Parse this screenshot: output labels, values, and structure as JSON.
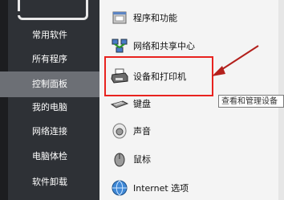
{
  "sidebar": {
    "items": [
      {
        "label": "常用软件",
        "active": false
      },
      {
        "label": "所有程序",
        "active": false
      },
      {
        "label": "控制面板",
        "active": true
      },
      {
        "label": "我的电脑",
        "active": false
      },
      {
        "label": "网络连接",
        "active": false
      },
      {
        "label": "电脑体检",
        "active": false
      },
      {
        "label": "软件卸载",
        "active": false
      }
    ]
  },
  "panel": {
    "items": [
      {
        "label": "程序和功能",
        "icon": "programs-icon"
      },
      {
        "label": "网络和共享中心",
        "icon": "network-icon"
      },
      {
        "label": "设备和打印机",
        "icon": "printer-icon"
      },
      {
        "label": "键盘",
        "icon": "keyboard-icon"
      },
      {
        "label": "声音",
        "icon": "speaker-icon"
      },
      {
        "label": "鼠标",
        "icon": "mouse-icon"
      },
      {
        "label": "Internet 选项",
        "icon": "internet-options-icon"
      }
    ]
  },
  "tooltip": {
    "text": "查看和管理设备"
  },
  "colors": {
    "highlight": "#e8231f",
    "sidebar_bg": "#2e3136",
    "sidebar_active": "#6c6f75"
  }
}
